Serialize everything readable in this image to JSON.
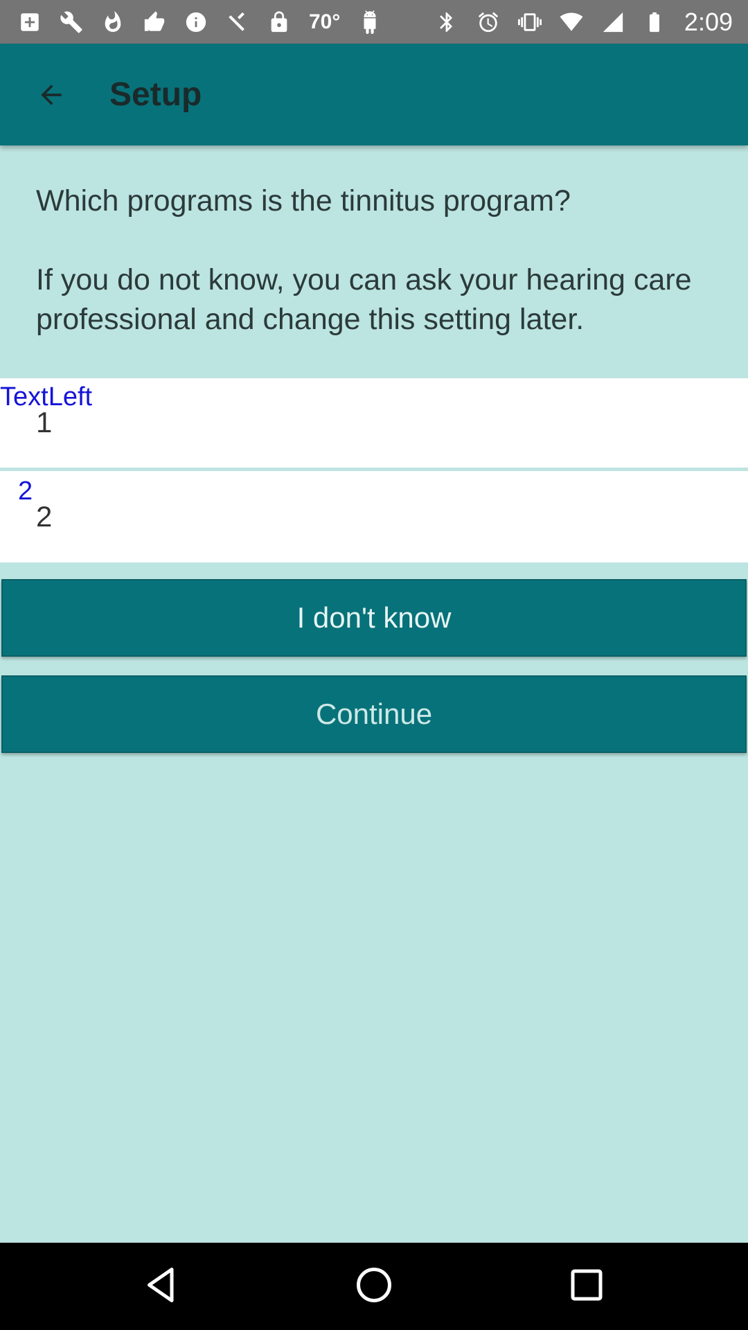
{
  "status_bar": {
    "temperature": "70°",
    "time": "2:09",
    "icons_left": [
      "add-box-icon",
      "wrench-icon",
      "flame-icon",
      "thumbs-up-icon",
      "info-icon",
      "satellite-fake-gps-icon",
      "lock-icon",
      "android-icon"
    ],
    "icons_right": [
      "bluetooth-icon",
      "alarm-icon",
      "vibrate-icon",
      "wifi-icon",
      "signal-icon",
      "battery-icon"
    ]
  },
  "app_bar": {
    "title": "Setup",
    "back_icon": "arrow-back-icon"
  },
  "instructions": {
    "question": "Which programs is the tinnitus program?",
    "hint": "If you do not know, you can ask your hearing care professional and change this setting later."
  },
  "programs": [
    {
      "small_label": "TextLeft",
      "value": "1"
    },
    {
      "small_label": "2",
      "value": "2"
    }
  ],
  "buttons": {
    "dont_know": "I don't know",
    "continue": "Continue"
  },
  "colors": {
    "primary": "#08727a",
    "background": "#bce4e0",
    "status_bar": "#757575",
    "link_blue": "#1414d8"
  }
}
